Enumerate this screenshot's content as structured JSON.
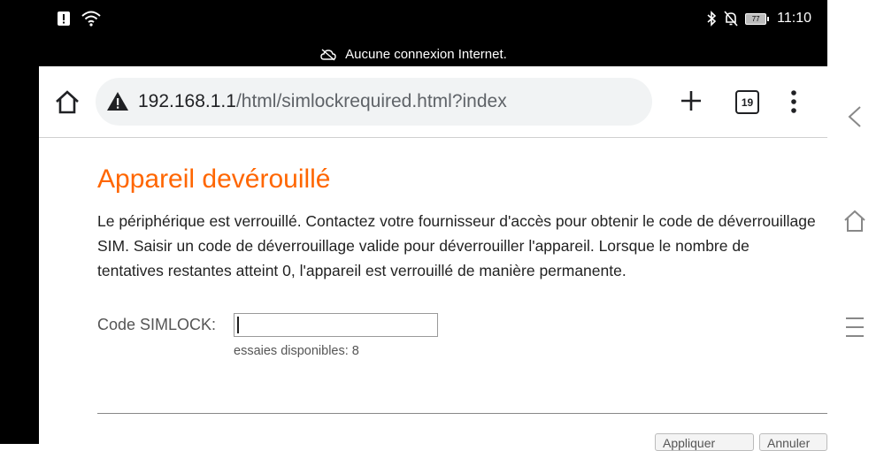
{
  "status_bar": {
    "time": "11:10",
    "battery_level": "77",
    "left_icons": [
      "alert-icon",
      "wifi-icon"
    ],
    "right_icons": [
      "bluetooth-icon",
      "bell-off-icon",
      "battery-icon"
    ]
  },
  "offline_banner": {
    "text": "Aucune connexion Internet.",
    "icon": "cloud-off-icon"
  },
  "browser": {
    "url_host": "192.168.1.1",
    "url_path": "/html/simlockrequired.html?index",
    "tab_count": "19"
  },
  "page": {
    "title": "Appareil devérouillé",
    "description": "Le périphérique est verrouillé. Contactez votre fournisseur d'accès pour obtenir le code de déverrouillage SIM. Saisir un code de déverrouillage valide pour déverrouiller l'appareil. Lorsque le nombre de tentatives restantes atteint 0, l'appareil est verrouillé de manière permanente.",
    "code_label": "Code SIMLOCK:",
    "code_value": "",
    "attempts_text": "essaies disponibles:  8",
    "apply_label": "Appliquer",
    "cancel_label": "Annuler"
  },
  "colors": {
    "title_accent": "#ff6600",
    "frame": "#000000",
    "url_pill": "#f1f3f4"
  }
}
